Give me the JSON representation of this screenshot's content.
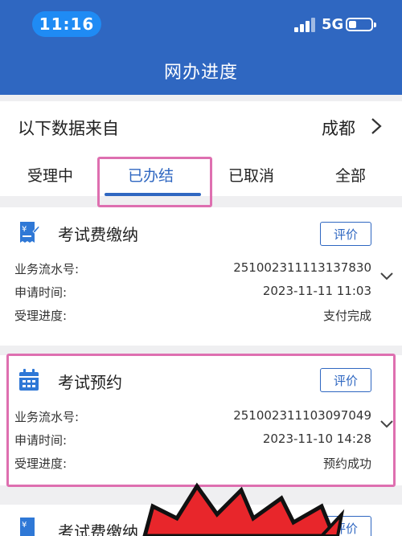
{
  "status_bar": {
    "time": "11:16",
    "network": "5G"
  },
  "header": {
    "title": "网办进度"
  },
  "source": {
    "label": "以下数据来自",
    "city": "成都"
  },
  "tabs": [
    {
      "label": "受理中"
    },
    {
      "label": "已办结",
      "active": true
    },
    {
      "label": "已取消"
    },
    {
      "label": "全部"
    }
  ],
  "cards": [
    {
      "title": "考试费缴纳",
      "icon": "receipt-icon",
      "rate_label": "评价",
      "rows": [
        {
          "key": "业务流水号:",
          "value": "251002311113137830"
        },
        {
          "key": "申请时间:",
          "value": "2023-11-11 11:03"
        },
        {
          "key": "受理进度:",
          "value": "支付完成"
        }
      ]
    },
    {
      "title": "考试预约",
      "icon": "calendar-icon",
      "rate_label": "评价",
      "rows": [
        {
          "key": "业务流水号:",
          "value": "251002311103097049"
        },
        {
          "key": "申请时间:",
          "value": "2023-11-10 14:28"
        },
        {
          "key": "受理进度:",
          "value": "预约成功"
        }
      ]
    },
    {
      "title": "考试费缴纳",
      "icon": "receipt-icon",
      "rate_label": "评价"
    }
  ],
  "colors": {
    "primary": "#2f67c1",
    "highlight": "#de6fb0",
    "sticker_red": "#e8262b"
  }
}
